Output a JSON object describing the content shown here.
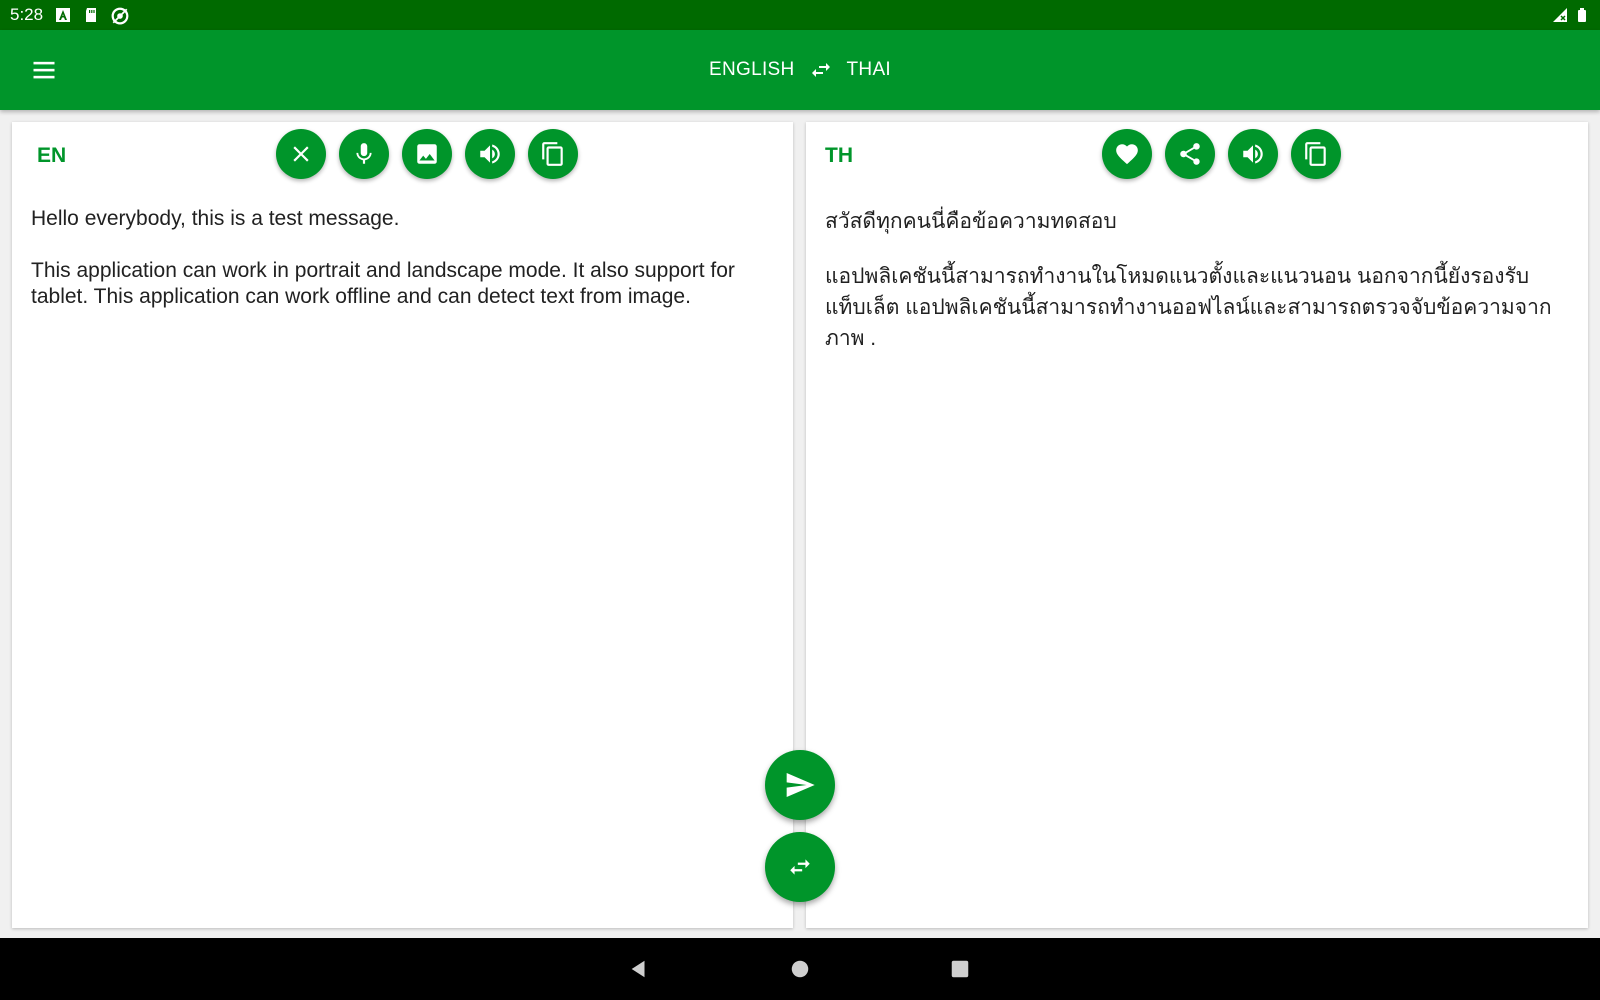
{
  "status_bar": {
    "time": "5:28",
    "left_icons": [
      "a-icon",
      "sd-card-icon",
      "sync-icon"
    ],
    "right_icons": [
      "signal-icon",
      "battery-icon"
    ]
  },
  "app_bar": {
    "menu_icon": "menu-icon",
    "source_language": "ENGLISH",
    "swap_icon": "swap-horiz-icon",
    "target_language": "THAI",
    "color": "#00952a"
  },
  "source_panel": {
    "lang_code": "EN",
    "tools": [
      "close-icon",
      "mic-icon",
      "image-icon",
      "volume-icon",
      "copy-icon"
    ],
    "paragraphs": [
      "Hello everybody, this is a test message.",
      "This application can work in portrait and landscape mode. It also support for tablet. This application can work offline and can detect text from image."
    ]
  },
  "target_panel": {
    "lang_code": "TH",
    "tools": [
      "heart-icon",
      "share-icon",
      "volume-icon",
      "copy-icon"
    ],
    "paragraphs": [
      "สวัสดีทุกคนนี่คือข้อความทดสอบ",
      "แอปพลิเคชันนี้สามารถทำงานในโหมดแนวตั้งและแนวนอน นอกจากนี้ยังรองรับแท็บเล็ต แอปพลิเคชันนี้สามารถทำงานออฟไลน์และสามารถตรวจจับข้อความจากภาพ ."
    ]
  },
  "fabs": {
    "translate_icon": "send-icon",
    "swap_icon": "swap-horiz-icon"
  },
  "nav_bar": {
    "icons": [
      "back-icon",
      "home-icon",
      "recents-icon"
    ]
  },
  "colors": {
    "status_bar": "#006a00",
    "accent": "#00952a",
    "text": "#212121"
  }
}
